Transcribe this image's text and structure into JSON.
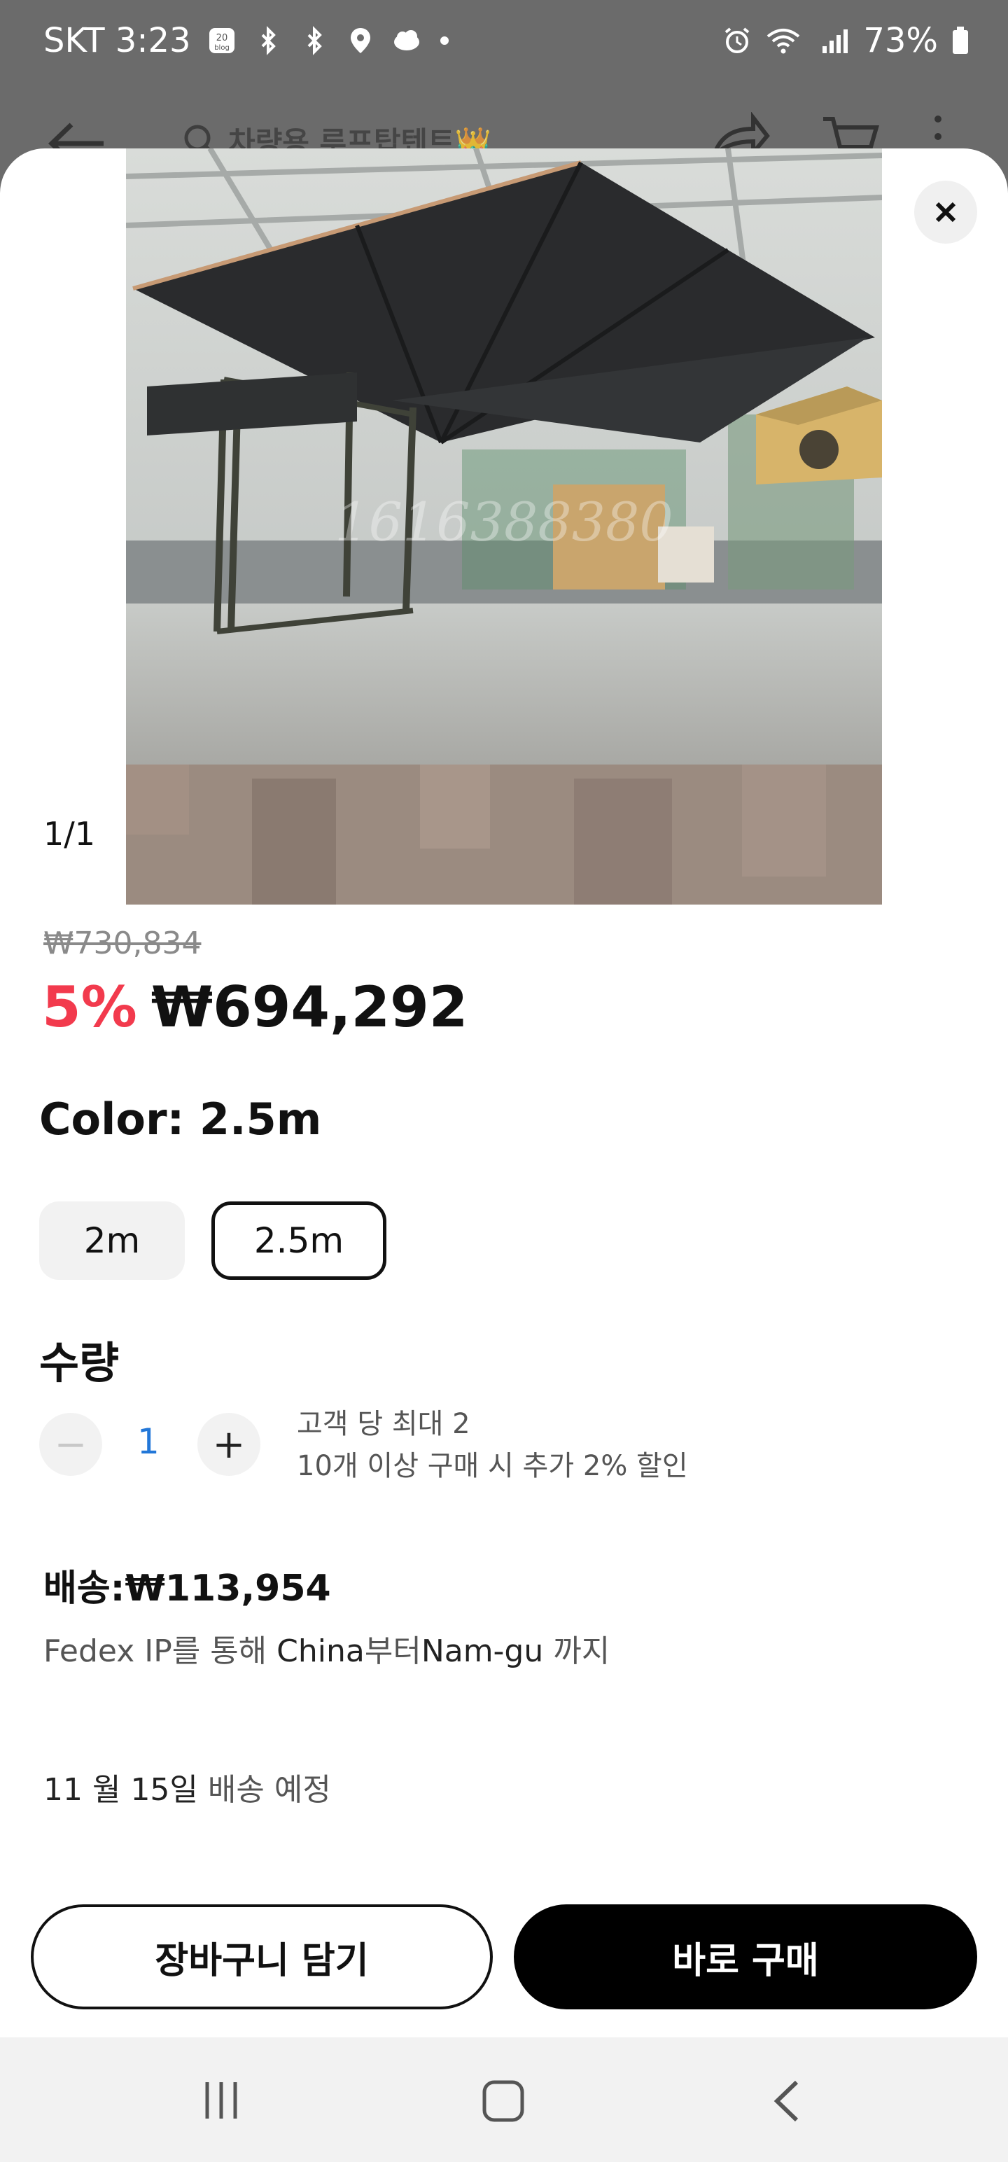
{
  "status_bar": {
    "carrier_time": "SKT 3:23",
    "icons": [
      "blog-icon",
      "bluetooth-off-icon",
      "bluetooth-off-icon",
      "location-icon",
      "cloud-icon",
      "dot-icon"
    ],
    "right_icons": [
      "alarm-icon",
      "wifi-icon",
      "signal-icon",
      "battery-icon"
    ],
    "battery": "73%"
  },
  "background_header": {
    "search_text": "차량용 루프탑텐트👑"
  },
  "gallery": {
    "counter": "1/1",
    "watermark": "1616388380"
  },
  "pricing": {
    "original_price": "₩730,834",
    "discount": "5%",
    "price": "₩694,292"
  },
  "option": {
    "title": "Color:  2.5m",
    "choices": [
      "2m",
      "2.5m"
    ],
    "selected": "2.5m"
  },
  "quantity": {
    "title": "수량",
    "minus": "−",
    "plus": "+",
    "value": "1",
    "note_line1": "고객 당 최대 2",
    "note_line2": "10개 이상 구매 시 추가 2% 할인"
  },
  "shipping": {
    "title": "배송:₩113,954",
    "route_prefix": "Fedex IP를 통해 ",
    "route_from": "China",
    "route_mid": "부터",
    "route_to": "Nam-gu",
    "route_suffix": " 까지",
    "eta_date": "11 월 15일",
    "eta_suffix": " 배송 예정"
  },
  "actions": {
    "cart_label": "장바구니 담기",
    "buy_label": "바로 구매"
  },
  "colors": {
    "discount": "#f23a4d",
    "quantity_value": "#2277d8",
    "buy_button": "#000000"
  }
}
